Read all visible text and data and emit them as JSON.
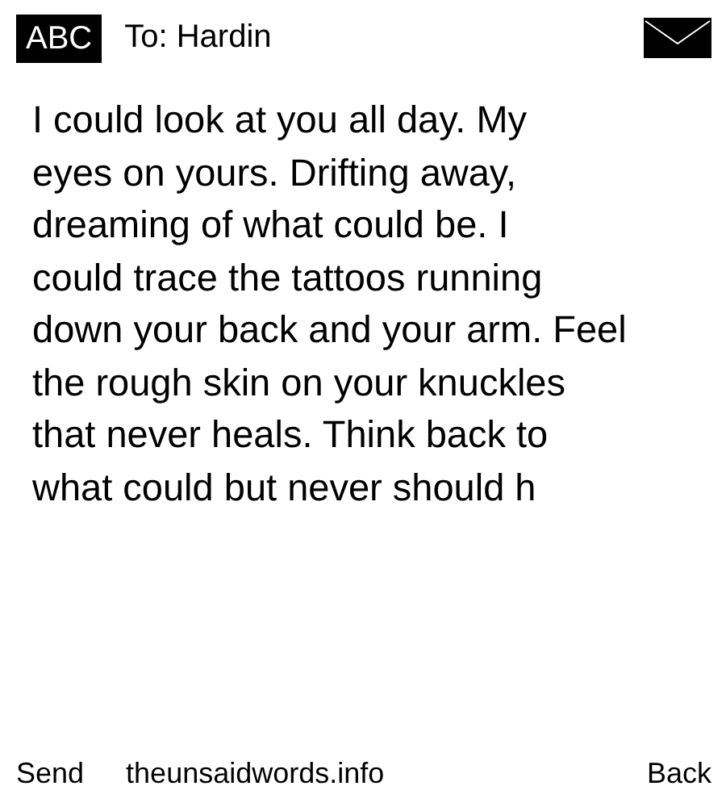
{
  "header": {
    "input_mode": "ABC",
    "recipient": "To: Hardin"
  },
  "message": "I could look at you all day. My\neyes on yours. Drifting away,\ndreaming of what could be. I\ncould trace the tattoos running\ndown your back and your arm. Feel\nthe rough skin on your knuckles\nthat never heals. Think back to\nwhat could but never should h",
  "softkeys": {
    "left": "Send",
    "center": "theunsaidwords.info",
    "right": "Back"
  }
}
